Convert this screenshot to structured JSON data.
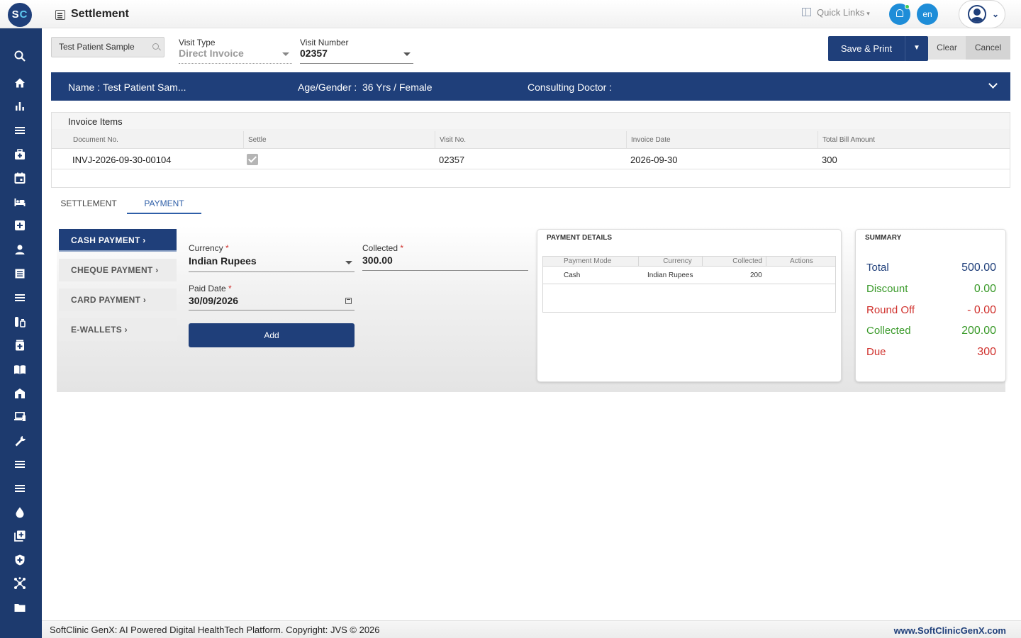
{
  "app": {
    "logo_text_1": "S",
    "logo_text_2": "C",
    "page_title": "Settlement",
    "quick_links": "Quick Links",
    "language": "en"
  },
  "sidebar": {
    "icons": [
      "search-icon",
      "home-icon",
      "bar-chart-icon",
      "menu-icon",
      "medical-bag-icon",
      "calendar-icon",
      "bed-icon",
      "add-box-icon",
      "person-icon",
      "list-alt-icon",
      "menu-icon",
      "pharmacy-icon",
      "medicine-icon",
      "book-icon",
      "hospital-icon",
      "devices-icon",
      "wrench-icon",
      "menu-icon",
      "menu-icon",
      "drop-icon",
      "library-add-icon",
      "shield-icon",
      "hub-icon",
      "folder-icon"
    ]
  },
  "form": {
    "patient_search_value": "Test Patient Sample",
    "visit_type_label": "Visit Type",
    "visit_type_value": "Direct Invoice",
    "visit_number_label": "Visit Number",
    "visit_number_value": "02357"
  },
  "actions": {
    "save_print": "Save & Print",
    "clear": "Clear",
    "cancel": "Cancel"
  },
  "banner": {
    "name_label": "Name :",
    "name_value": "Test Patient Sam...",
    "age_gender_label": "Age/Gender :",
    "age_gender_value": "36 Yrs / Female",
    "consulting_doctor_label": "Consulting Doctor :",
    "consulting_doctor_value": ""
  },
  "invoice": {
    "title": "Invoice Items",
    "columns": [
      "Document No.",
      "Settle",
      "Visit No.",
      "Invoice Date",
      "Total Bill Amount"
    ],
    "rows": [
      {
        "document_no": "INVJ-2026-09-30-00104",
        "settle": true,
        "visit_no": "02357",
        "invoice_date": "2026-09-30",
        "total_bill_amount": "300"
      }
    ]
  },
  "tabs": [
    {
      "label": "SETTLEMENT",
      "active": false
    },
    {
      "label": "PAYMENT",
      "active": true
    }
  ],
  "payment_modes": [
    {
      "label": "CASH PAYMENT",
      "active": true
    },
    {
      "label": "CHEQUE PAYMENT",
      "active": false
    },
    {
      "label": "CARD PAYMENT",
      "active": false
    },
    {
      "label": "E-WALLETS",
      "active": false
    }
  ],
  "cash_form": {
    "currency_label": "Currency",
    "currency_value": "Indian Rupees",
    "collected_label": "Collected",
    "collected_value": "300.00",
    "paid_date_label": "Paid Date",
    "paid_date_value": "30/09/2026",
    "add_button": "Add",
    "required_mark": "*"
  },
  "payment_details": {
    "title": "PAYMENT DETAILS",
    "columns": [
      "Payment Mode",
      "Currency",
      "Collected",
      "Actions"
    ],
    "rows": [
      {
        "mode": "Cash",
        "currency": "Indian Rupees",
        "collected": "200",
        "actions": ""
      }
    ]
  },
  "summary": {
    "title": "SUMMARY",
    "items": [
      {
        "label": "Total",
        "value": "500.00",
        "color": "#1f3f7a"
      },
      {
        "label": "Discount",
        "value": "0.00",
        "color": "#3a9a2a"
      },
      {
        "label": "Round Off",
        "value": "- 0.00",
        "color": "#d0312d"
      },
      {
        "label": "Collected",
        "value": "200.00",
        "color": "#3a9a2a"
      },
      {
        "label": "Due",
        "value": "300",
        "color": "#d0312d"
      }
    ]
  },
  "footer": {
    "left": "SoftClinic GenX: AI Powered Digital HealthTech Platform. Copyright: JVS © 2026",
    "right": "www.SoftClinicGenX.com"
  },
  "colors": {
    "primary": "#1f3f7a",
    "sidebar": "#1d3a6e",
    "accent_blue": "#1e8dd8",
    "tab_active": "#2f5fa8",
    "green": "#3a9a2a",
    "red": "#d0312d"
  }
}
